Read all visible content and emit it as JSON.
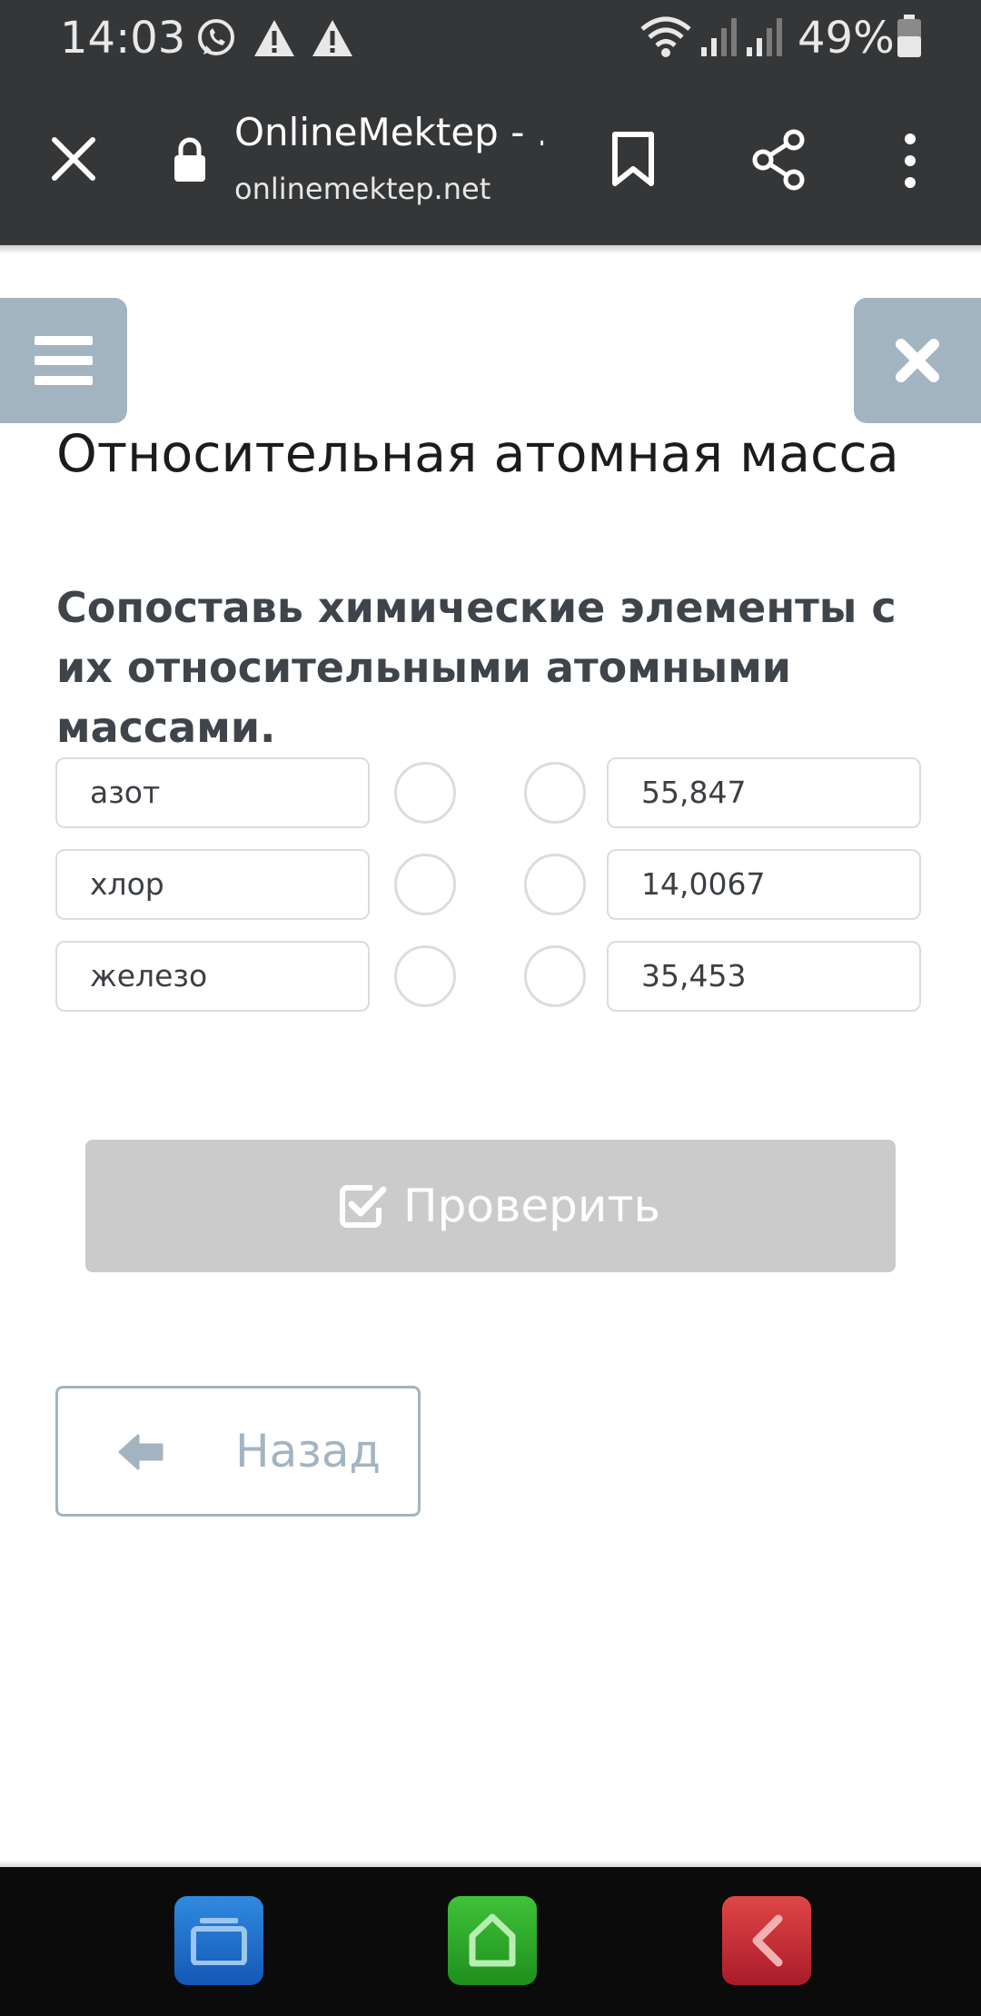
{
  "status_bar": {
    "time": "14:03",
    "battery": "49%",
    "icons": [
      "whatsapp-icon",
      "warning-icon",
      "warning-icon",
      "wifi-icon",
      "signal-icon",
      "signal-icon",
      "battery-icon"
    ]
  },
  "browser": {
    "page_title": "OnlineMektep - ...",
    "url": "onlinemektep.net",
    "icons": [
      "close-icon",
      "lock-icon",
      "bookmark-icon",
      "share-icon",
      "more-vert-icon"
    ]
  },
  "lesson": {
    "title": "Относительная атомная масса",
    "question": "Сопоставь химические элементы с их относительными атомными массами.",
    "left_items": [
      "азот",
      "хлор",
      "железо"
    ],
    "right_items": [
      "55,847",
      "14,0067",
      "35,453"
    ]
  },
  "buttons": {
    "check": "Проверить",
    "back": "Назад"
  },
  "colors": {
    "toolbar": "#343638",
    "accent": "#a3b4c1",
    "check_disabled": "#cbcbcb",
    "question_text": "#3e444a"
  },
  "dock": {
    "icons": [
      "recent-apps-icon",
      "home-icon",
      "back-icon"
    ]
  }
}
